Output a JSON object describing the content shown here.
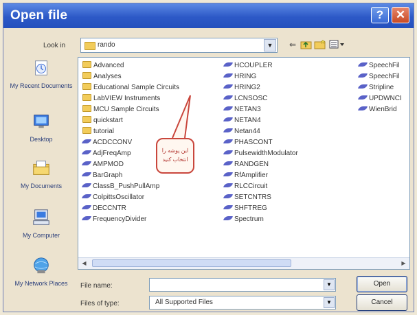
{
  "window": {
    "title": "Open file",
    "help_label": "?",
    "close_label": "✕"
  },
  "toolbar": {
    "look_in_label": "Look in",
    "look_in_value": "rando",
    "icons": [
      "back-icon",
      "up-folder-icon",
      "new-folder-icon",
      "view-menu-icon"
    ]
  },
  "places": [
    {
      "name": "My Recent Documents",
      "icon": "recent-documents-icon"
    },
    {
      "name": "Desktop",
      "icon": "desktop-icon"
    },
    {
      "name": "My Documents",
      "icon": "my-documents-icon"
    },
    {
      "name": "My Computer",
      "icon": "my-computer-icon"
    },
    {
      "name": "My Network Places",
      "icon": "network-places-icon"
    }
  ],
  "files": {
    "column1": [
      {
        "name": "Advanced",
        "type": "folder"
      },
      {
        "name": "Analyses",
        "type": "folder"
      },
      {
        "name": "Educational Sample Circuits",
        "type": "folder"
      },
      {
        "name": "LabVIEW Instruments",
        "type": "folder"
      },
      {
        "name": "MCU Sample Circuits",
        "type": "folder"
      },
      {
        "name": "quickstart",
        "type": "folder"
      },
      {
        "name": "tutorial",
        "type": "folder"
      },
      {
        "name": "ACDCCONV",
        "type": "file"
      },
      {
        "name": "AdjFreqAmp",
        "type": "file"
      },
      {
        "name": "AMPMOD",
        "type": "file"
      },
      {
        "name": "BarGraph",
        "type": "file"
      },
      {
        "name": "ClassB_PushPullAmp",
        "type": "file"
      },
      {
        "name": "ColpittsOscillator",
        "type": "file"
      },
      {
        "name": "DECCNTR",
        "type": "file"
      },
      {
        "name": "FrequencyDivider",
        "type": "file"
      }
    ],
    "column2": [
      {
        "name": "HCOUPLER",
        "type": "file"
      },
      {
        "name": "HRING",
        "type": "file"
      },
      {
        "name": "HRING2",
        "type": "file"
      },
      {
        "name": "LCNSOSC",
        "type": "file"
      },
      {
        "name": "NETAN3",
        "type": "file"
      },
      {
        "name": "NETAN4",
        "type": "file"
      },
      {
        "name": "Netan44",
        "type": "file"
      },
      {
        "name": "PHASCONT",
        "type": "file"
      },
      {
        "name": "PulsewidthModulator",
        "type": "file"
      },
      {
        "name": "RANDGEN",
        "type": "file"
      },
      {
        "name": "RfAmplifier",
        "type": "file"
      },
      {
        "name": "RLCCircuit",
        "type": "file"
      },
      {
        "name": "SETCNTRS",
        "type": "file"
      },
      {
        "name": "SHFTREG",
        "type": "file"
      },
      {
        "name": "Spectrum",
        "type": "file"
      }
    ],
    "column3": [
      {
        "name": "SpeechFil",
        "type": "file"
      },
      {
        "name": "SpeechFil",
        "type": "file"
      },
      {
        "name": "Stripline",
        "type": "file"
      },
      {
        "name": "UPDWNCI",
        "type": "file"
      },
      {
        "name": "WienBrid",
        "type": "file"
      }
    ]
  },
  "callout": {
    "line1": "این پوشه را",
    "line2": "انتخاب کنید"
  },
  "bottom": {
    "file_name_label": "File name:",
    "file_name_value": "",
    "file_type_label": "Files of type:",
    "file_type_value": "All Supported Files",
    "open_label": "Open",
    "cancel_label": "Cancel"
  },
  "colors": {
    "title_blue": "#2d59c7",
    "close_red": "#c84a24",
    "file_icon": "#5a62c8",
    "folder": "#f2cc5a",
    "callout": "#c9463c"
  }
}
